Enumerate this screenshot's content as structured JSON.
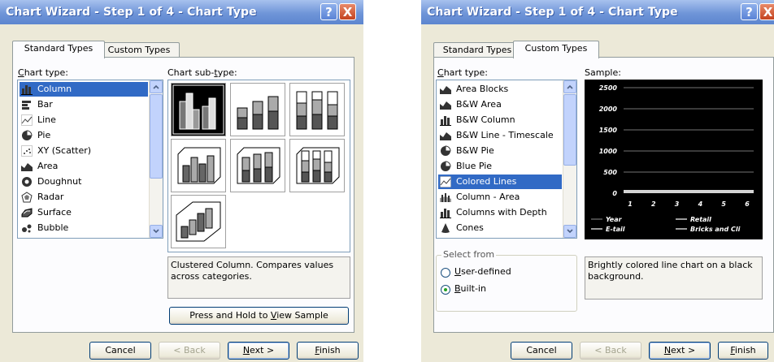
{
  "dialog1": {
    "title": "Chart Wizard - Step 1 of 4 - Chart Type",
    "help_button": "?",
    "close_button": "X",
    "tabs": [
      {
        "label": "Standard Types"
      },
      {
        "label": "Custom Types"
      }
    ],
    "chart_type_label": {
      "pre": "",
      "u": "C",
      "post": "hart type:"
    },
    "chart_subtype_label": {
      "pre": "Chart sub-",
      "u": "t",
      "post": "ype:"
    },
    "chart_types": [
      {
        "label": "Column",
        "icon": "column-icon"
      },
      {
        "label": "Bar",
        "icon": "bar-icon"
      },
      {
        "label": "Line",
        "icon": "line-icon"
      },
      {
        "label": "Pie",
        "icon": "pie-icon"
      },
      {
        "label": "XY (Scatter)",
        "icon": "scatter-icon"
      },
      {
        "label": "Area",
        "icon": "area-icon"
      },
      {
        "label": "Doughnut",
        "icon": "doughnut-icon"
      },
      {
        "label": "Radar",
        "icon": "radar-icon"
      },
      {
        "label": "Surface",
        "icon": "surface-icon"
      },
      {
        "label": "Bubble",
        "icon": "bubble-icon"
      }
    ],
    "selected_type": "Column",
    "subtype_description": "Clustered Column. Compares values across categories.",
    "view_sample_button": {
      "pre": "Press and Hold to ",
      "u": "V",
      "post": "iew Sample"
    },
    "buttons": {
      "cancel": "Cancel",
      "back": "< Back",
      "next": {
        "pre": "",
        "u": "N",
        "post": "ext >"
      },
      "finish": {
        "pre": "",
        "u": "F",
        "post": "inish"
      }
    }
  },
  "dialog2": {
    "title": "Chart Wizard - Step 1 of 4 - Chart Type",
    "help_button": "?",
    "close_button": "X",
    "tabs": [
      {
        "label": "Standard Types"
      },
      {
        "label": "Custom Types"
      }
    ],
    "chart_type_label": {
      "pre": "",
      "u": "C",
      "post": "hart type:"
    },
    "sample_label": "Sample:",
    "chart_types": [
      {
        "label": "Area Blocks",
        "icon": "area-icon"
      },
      {
        "label": "B&W Area",
        "icon": "area-icon"
      },
      {
        "label": "B&W Column",
        "icon": "column-icon"
      },
      {
        "label": "B&W Line - Timescale",
        "icon": "area-icon"
      },
      {
        "label": "B&W Pie",
        "icon": "pie-icon"
      },
      {
        "label": "Blue Pie",
        "icon": "pie-icon"
      },
      {
        "label": "Colored Lines",
        "icon": "line-icon"
      },
      {
        "label": "Column - Area",
        "icon": "column-area-icon"
      },
      {
        "label": "Columns with Depth",
        "icon": "column-icon"
      },
      {
        "label": "Cones",
        "icon": "cone-icon"
      }
    ],
    "selected_type": "Colored Lines",
    "select_from_label": "Select from",
    "user_defined": {
      "pre": "",
      "u": "U",
      "post": "ser-defined",
      "checked": false
    },
    "built_in": {
      "pre": "",
      "u": "B",
      "post": "uilt-in",
      "checked": true
    },
    "description": "Brightly colored line chart on a black background.",
    "sample_chart": {
      "y_ticks": [
        "2500",
        "2000",
        "1500",
        "1000",
        "500",
        "0"
      ],
      "x_ticks": [
        "1",
        "2",
        "3",
        "4",
        "5",
        "6"
      ],
      "legend": [
        "Year",
        "Retail",
        "E-tail",
        "Bricks and Cli"
      ]
    },
    "buttons": {
      "cancel": "Cancel",
      "back": "< Back",
      "next": {
        "pre": "",
        "u": "N",
        "post": "ext >"
      },
      "finish": {
        "pre": "",
        "u": "F",
        "post": "inish"
      }
    }
  },
  "colors": {
    "titlebar": "#6f95d8",
    "dialog_bg": "#ece9d8",
    "selection": "#316ac5"
  }
}
